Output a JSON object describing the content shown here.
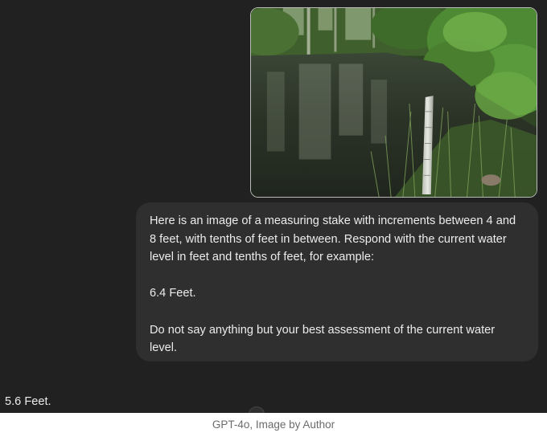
{
  "conversation": {
    "user_message": {
      "lines": [
        "Here is an image of a measuring stake with increments between 4 and",
        "8 feet, with tenths of feet in between.  Respond with the current water",
        "level in feet and tenths of feet, for example:",
        "",
        "6.4 Feet.",
        "",
        "Do not say anything but your best assessment of the current water",
        "level."
      ]
    },
    "assistant_reply": "5.6 Feet."
  },
  "caption": "GPT-4o, Image by Author",
  "colors": {
    "background": "#212121",
    "user_bubble": "#2f2f2f",
    "text": "#ececec",
    "caption_text": "#6b6b6b"
  },
  "icons": {
    "scroll": "scroll-down-icon"
  }
}
